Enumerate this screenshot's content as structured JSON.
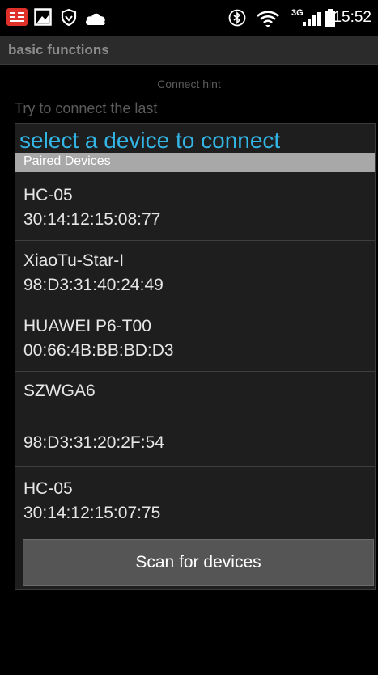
{
  "status_bar": {
    "time": "15:52",
    "network_label": "3G",
    "icons": [
      "news-app-icon",
      "image-icon",
      "shield-icon",
      "cloud-icon",
      "bluetooth-icon",
      "wifi-icon",
      "signal-icon",
      "battery-icon"
    ]
  },
  "app_bar": {
    "title": "basic functions"
  },
  "background": {
    "hint": "Connect hint",
    "line": "Try to connect the last"
  },
  "dialog": {
    "title": "select a device to connect",
    "section_header": "Paired Devices",
    "devices": [
      {
        "name": "HC-05",
        "address": "30:14:12:15:08:77"
      },
      {
        "name": "XiaoTu-Star-I",
        "address": "98:D3:31:40:24:49"
      },
      {
        "name": "HUAWEI P6-T00",
        "address": "00:66:4B:BB:BD:D3"
      },
      {
        "name": "SZWGA6",
        "address": "98:D3:31:20:2F:54"
      },
      {
        "name": "HC-05",
        "address": "30:14:12:15:07:75"
      }
    ],
    "scan_button": "Scan for devices"
  },
  "colors": {
    "accent": "#33b5e5",
    "section_header": "#a8a8a8",
    "dialog_background": "#1e1e1e",
    "button": "#555555"
  }
}
